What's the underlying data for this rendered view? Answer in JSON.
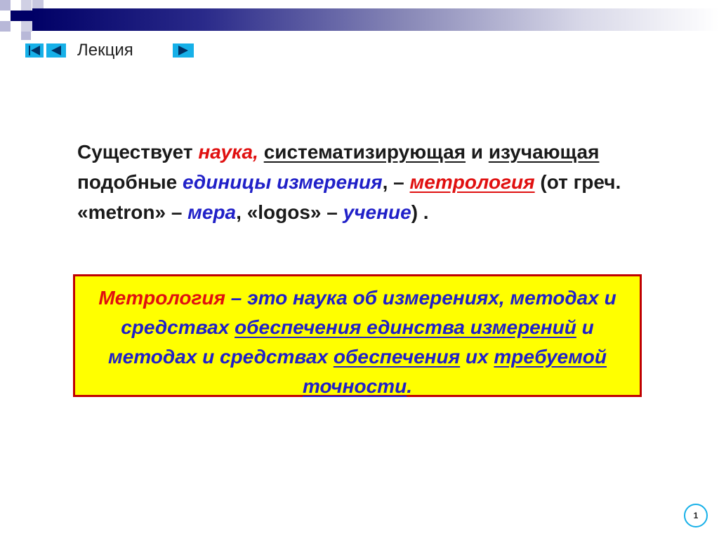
{
  "nav": {
    "label": "Лекция",
    "first_icon": "first-slide-icon",
    "prev_icon": "prev-slide-icon",
    "next_icon": "next-slide-icon"
  },
  "paragraph": {
    "p1": "Существует ",
    "p2": "наука,",
    "p3": " ",
    "p4": "систематизирующая",
    "p5": " и ",
    "p6": "изучающая",
    "p7": " подобные ",
    "p8": "единицы измерения",
    "p9": ", – ",
    "p10": "метрология",
    "p11": " (от греч. «metron» – ",
    "p12": "мера",
    "p13": ", «logos» – ",
    "p14": "учение",
    "p15": ") ."
  },
  "definition": {
    "d1": "Метрология",
    "d2": " – это наука об измерениях, методах и средствах ",
    "d3": "обеспечения единства измерений",
    "d4": " и методах и средствах ",
    "d5": "обеспечения",
    "d6": " их ",
    "d7": "требуемой точности",
    "d8": "."
  },
  "page_number": "1",
  "colors": {
    "accent_red": "#e01010",
    "accent_blue": "#2020c8",
    "box_fill": "#ffff00",
    "box_border": "#c00000",
    "nav_button": "#16b0e8"
  }
}
